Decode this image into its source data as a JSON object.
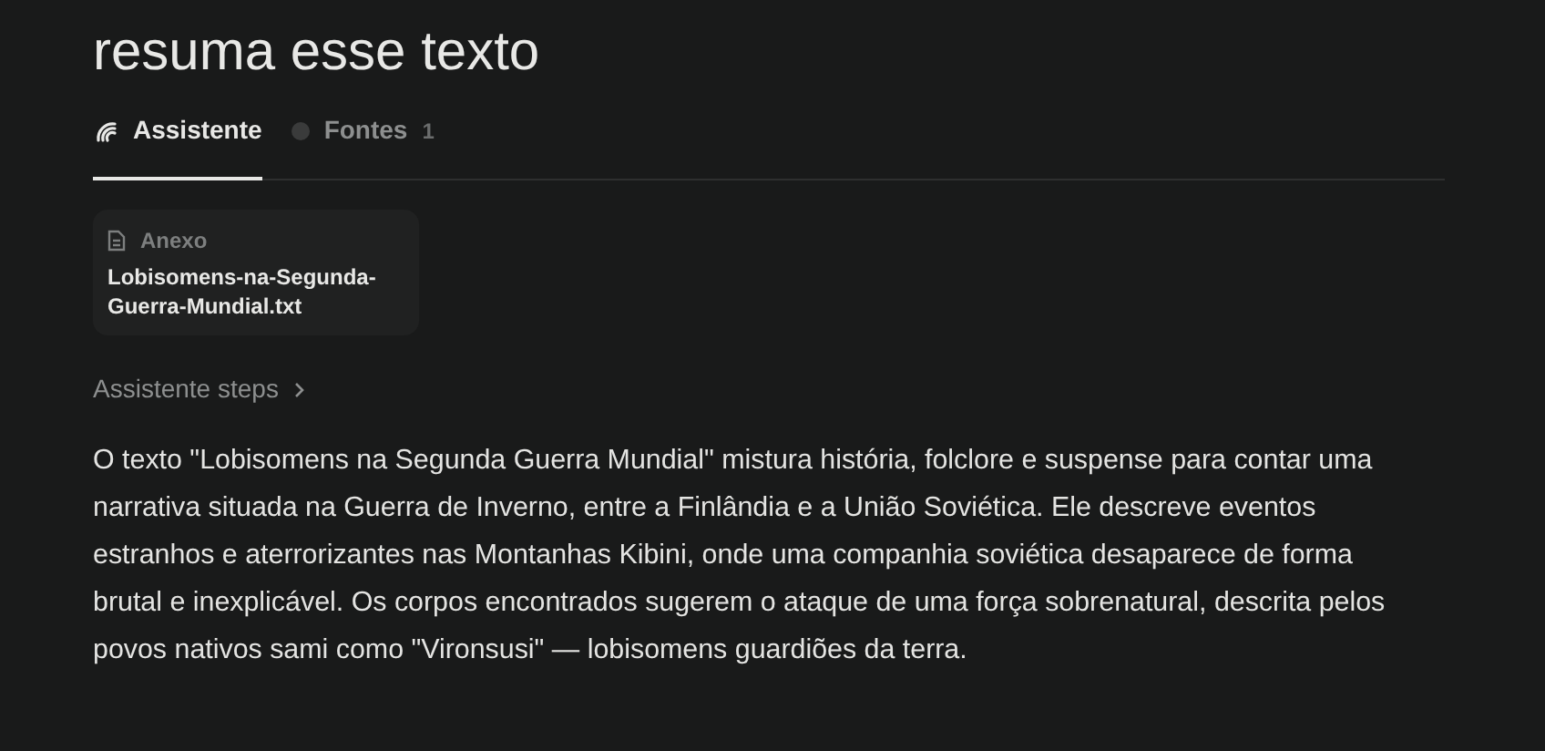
{
  "title": "resuma esse texto",
  "tabs": [
    {
      "label": "Assistente",
      "kind": "assistant",
      "selected": true
    },
    {
      "label": "Fontes",
      "kind": "sources",
      "count": "1",
      "selected": false
    }
  ],
  "attachment": {
    "label": "Anexo",
    "filename": "Lobisomens-na-Segunda-Guerra-Mundial.txt"
  },
  "steps": {
    "label": "Assistente steps",
    "expanded": false
  },
  "answer": "O texto \"Lobisomens na Segunda Guerra Mundial\" mistura história, folclore e suspense para contar uma narrativa situada na Guerra de Inverno, entre a Finlândia e a União Soviética. Ele descreve eventos estranhos e aterrorizantes nas Montanhas Kibini, onde uma companhia soviética desaparece de forma brutal e inexplicável. Os corpos encontrados sugerem o ataque de uma força sobrenatural, descrita pelos povos nativos sami como \"Vironsusi\" — lobisomens guardiões da terra."
}
